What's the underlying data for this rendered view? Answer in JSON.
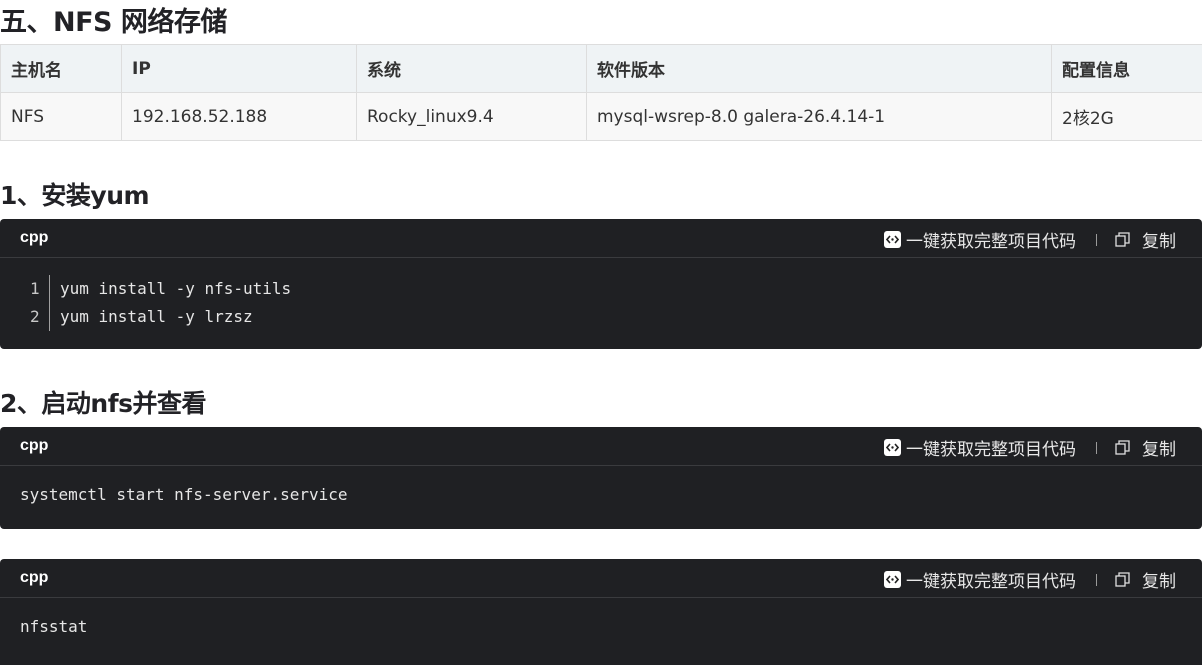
{
  "section_title": "五、NFS 网络存储",
  "table": {
    "headers": [
      "主机名",
      "IP",
      "系统",
      "软件版本",
      "配置信息"
    ],
    "rows": [
      [
        "NFS",
        "192.168.52.188",
        "Rocky_linux9.4",
        "mysql-wsrep-8.0 galera-26.4.14-1",
        "2核2G"
      ]
    ]
  },
  "step1": {
    "title": "1、安装yum",
    "code": {
      "lang": "cpp",
      "project_label": "一键获取完整项目代码",
      "copy_label": "复制",
      "line_numbers": [
        "1",
        "2"
      ],
      "lines": [
        "yum install -y nfs-utils",
        "yum install -y lrzsz"
      ]
    }
  },
  "step2": {
    "title": "2、启动nfs并查看",
    "code_a": {
      "lang": "cpp",
      "project_label": "一键获取完整项目代码",
      "copy_label": "复制",
      "line": "systemctl start nfs-server.service"
    },
    "code_b": {
      "lang": "cpp",
      "project_label": "一键获取完整项目代码",
      "copy_label": "复制",
      "line": "nfsstat"
    }
  }
}
